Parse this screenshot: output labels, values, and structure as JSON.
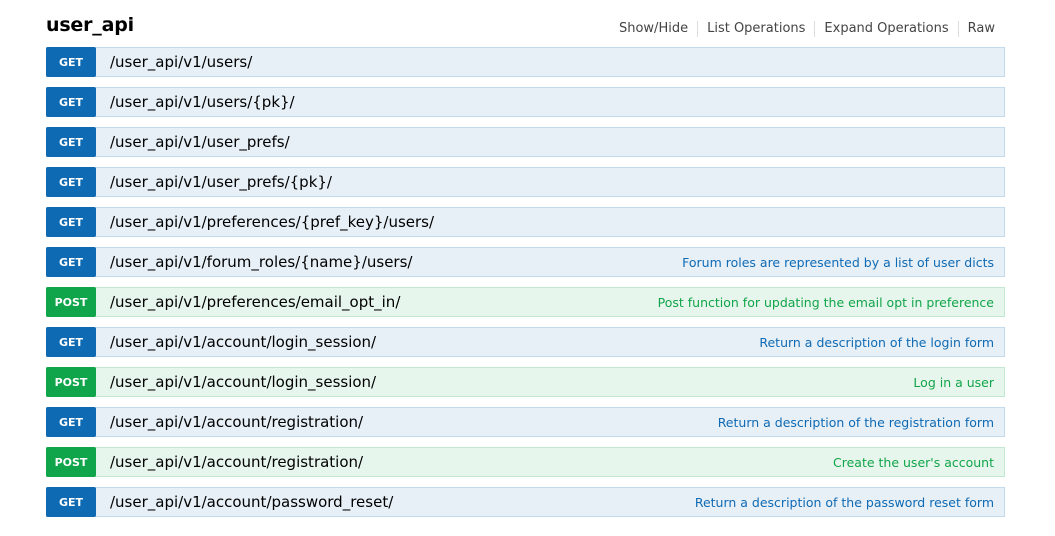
{
  "title": "user_api",
  "header_links": {
    "show_hide": "Show/Hide",
    "list_operations": "List Operations",
    "expand_operations": "Expand Operations",
    "raw": "Raw"
  },
  "colors": {
    "get_method": "#0f6ab4",
    "post_method": "#10a54a",
    "get_background": "#e7f0f7",
    "post_background": "#e7f6ec"
  },
  "operations": [
    {
      "method": "GET",
      "path": "/user_api/v1/users/",
      "summary": ""
    },
    {
      "method": "GET",
      "path": "/user_api/v1/users/{pk}/",
      "summary": ""
    },
    {
      "method": "GET",
      "path": "/user_api/v1/user_prefs/",
      "summary": ""
    },
    {
      "method": "GET",
      "path": "/user_api/v1/user_prefs/{pk}/",
      "summary": ""
    },
    {
      "method": "GET",
      "path": "/user_api/v1/preferences/{pref_key}/users/",
      "summary": ""
    },
    {
      "method": "GET",
      "path": "/user_api/v1/forum_roles/{name}/users/",
      "summary": "Forum roles are represented by a list of user dicts"
    },
    {
      "method": "POST",
      "path": "/user_api/v1/preferences/email_opt_in/",
      "summary": "Post function for updating the email opt in preference"
    },
    {
      "method": "GET",
      "path": "/user_api/v1/account/login_session/",
      "summary": "Return a description of the login form"
    },
    {
      "method": "POST",
      "path": "/user_api/v1/account/login_session/",
      "summary": "Log in a user"
    },
    {
      "method": "GET",
      "path": "/user_api/v1/account/registration/",
      "summary": "Return a description of the registration form"
    },
    {
      "method": "POST",
      "path": "/user_api/v1/account/registration/",
      "summary": "Create the user's account"
    },
    {
      "method": "GET",
      "path": "/user_api/v1/account/password_reset/",
      "summary": "Return a description of the password reset form"
    }
  ]
}
